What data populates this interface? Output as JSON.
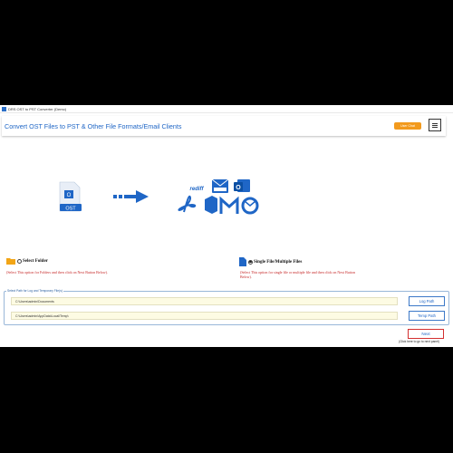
{
  "window": {
    "title": "DRS OST to PST Converter (Demo)"
  },
  "header": {
    "heading": "Convert OST Files to PST & Other File Formats/Email Clients",
    "user_chat": "User Chat"
  },
  "graphic": {
    "source_icon": "ost-file-icon",
    "source_label": "OST",
    "arrow": "arrow-right-icon",
    "targets": [
      "rediffmail-icon",
      "mbox-icon",
      "outlook-icon",
      "pdf-icon",
      "office365-icon",
      "gmail-icon",
      "thunderbird-icon"
    ]
  },
  "options": {
    "folder": {
      "label": "Select Folder",
      "checked": false,
      "hint": "(Select This option for Folders and then click on Next Button Below)."
    },
    "files": {
      "label": "Single File/Multiple Files",
      "checked": true,
      "hint": "(Select This option for single file or multiple file and then click on Next Button Below)."
    }
  },
  "paths": {
    "legend": "Select Path for Log and Temporary File(s)",
    "log_path": "C:\\Users\\admin\\Documents",
    "log_button": "Log Path",
    "temp_path": "C:\\Users\\admin\\AppData\\Local\\Temp\\",
    "temp_button": "Temp Path"
  },
  "next": {
    "label": "Next",
    "hint": "(Click here to go to next panel)"
  },
  "colors": {
    "accent": "#1f66c6",
    "orange": "#f29a1d",
    "hint_red": "#c62828",
    "next_border": "#d32f2f"
  }
}
